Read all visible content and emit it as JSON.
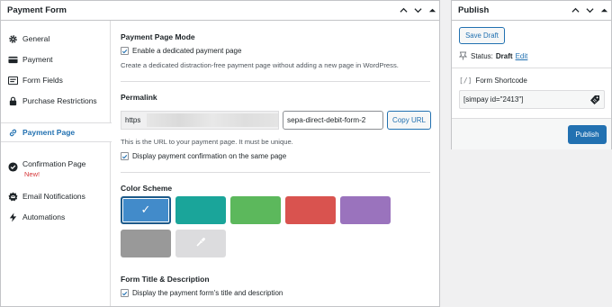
{
  "payment_form": {
    "title": "Payment Form",
    "sidebar": [
      {
        "label": "General",
        "icon": "gear-icon"
      },
      {
        "label": "Payment",
        "icon": "credit-card-icon"
      },
      {
        "label": "Form Fields",
        "icon": "form-fields-icon"
      },
      {
        "label": "Purchase Restrictions",
        "icon": "padlock-icon"
      },
      {
        "label": "Payment Page",
        "icon": "link-icon",
        "active": true
      },
      {
        "label": "Confirmation Page",
        "icon": "check-circle-icon",
        "badge": "New!"
      },
      {
        "label": "Email Notifications",
        "icon": "email-badge-icon"
      },
      {
        "label": "Automations",
        "icon": "lightning-icon"
      }
    ],
    "payment_page_mode": {
      "title": "Payment Page Mode",
      "checkbox_label": "Enable a dedicated payment page",
      "help": "Create a dedicated distraction-free payment page without adding a new page in WordPress."
    },
    "permalink": {
      "title": "Permalink",
      "base": "https",
      "slug": "sepa-direct-debit-form-2",
      "copy_label": "Copy URL",
      "help": "This is the URL to your payment page. It must be unique.",
      "checkbox_label": "Display payment confirmation on the same page"
    },
    "color_scheme": {
      "title": "Color Scheme",
      "swatches": [
        "#428bca",
        "#1aa59a",
        "#5cb85c",
        "#d9534f",
        "#9a73bd",
        "#999999"
      ],
      "selected_index": 0,
      "check_glyph": "✓"
    },
    "form_title_description": {
      "title": "Form Title & Description",
      "checkbox_label": "Display the payment form's title and description"
    }
  },
  "publish": {
    "title": "Publish",
    "save_draft_label": "Save Draft",
    "status_label": "Status:",
    "status_value": "Draft",
    "edit_label": "Edit",
    "shortcode_label": "Form Shortcode",
    "shortcode_value": "[simpay id=\"2413\"]",
    "publish_label": "Publish"
  },
  "colors": {
    "accent": "#2271b1",
    "new_badge": "#d63638"
  }
}
